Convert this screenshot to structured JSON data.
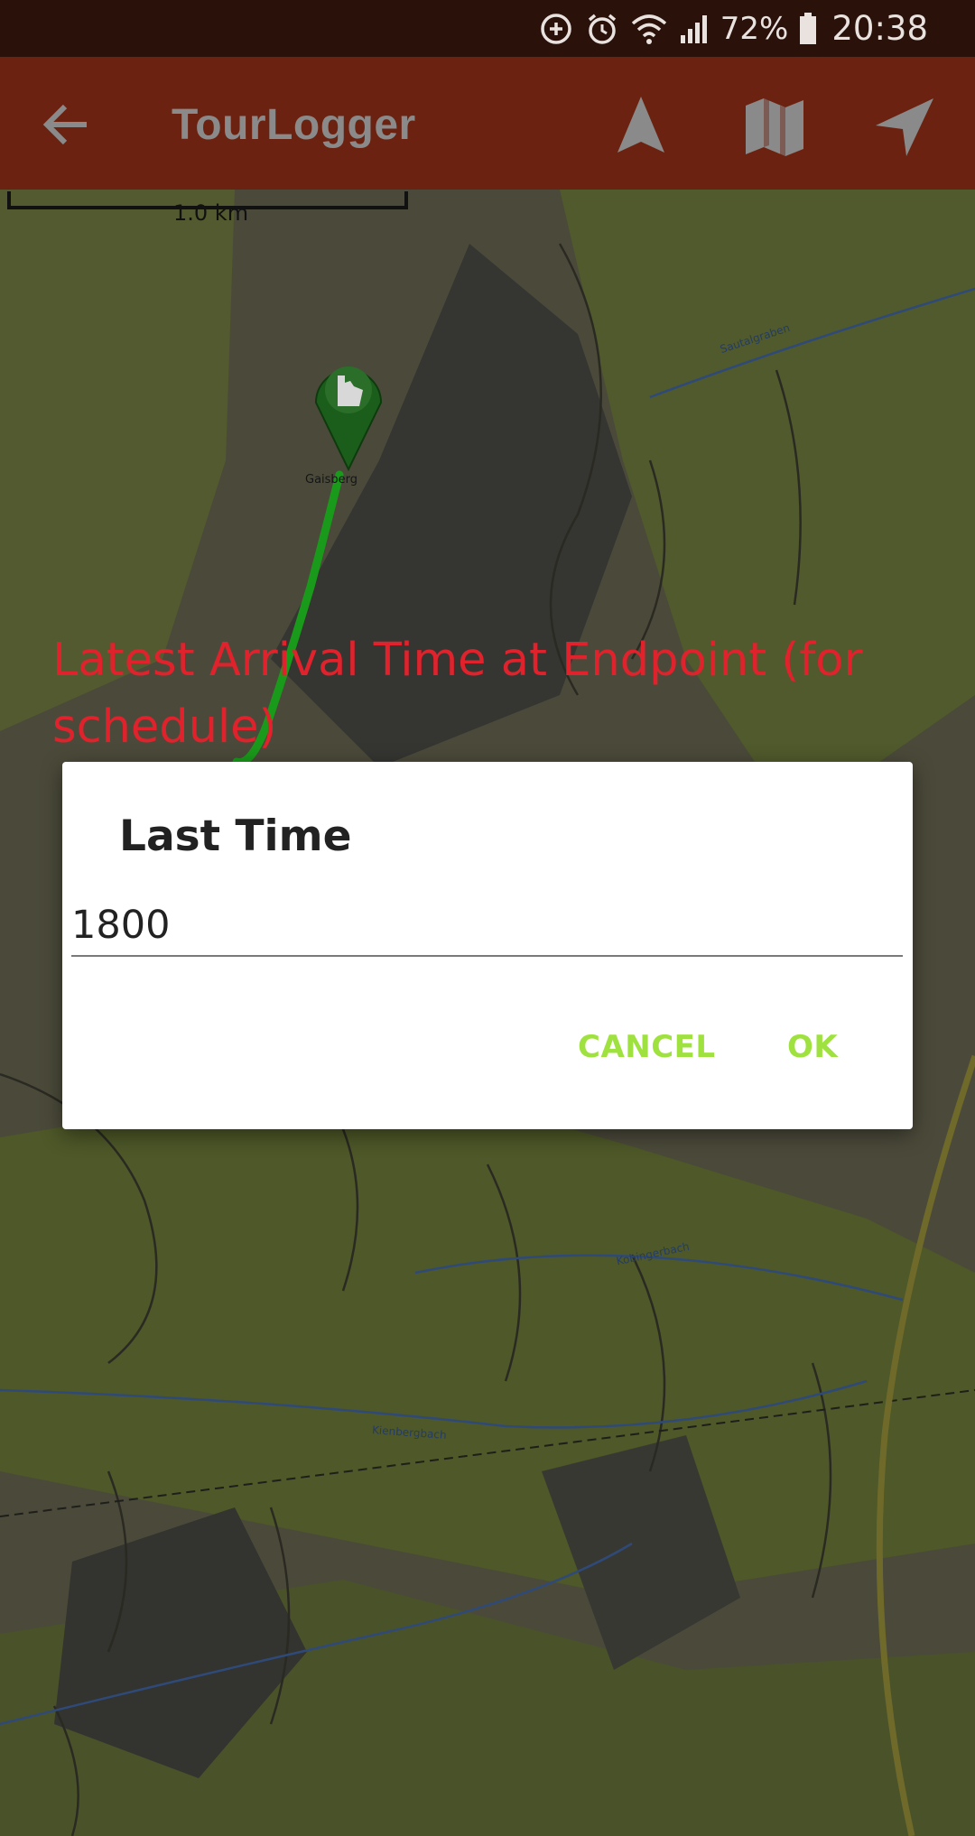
{
  "status_bar": {
    "battery_percent": "72%",
    "time": "20:38",
    "icons": [
      "sync-plus-icon",
      "alarm-icon",
      "wifi-icon",
      "signal-icon",
      "battery-icon"
    ]
  },
  "app_bar": {
    "title": "TourLogger",
    "back_icon": "arrow-back-icon",
    "actions": [
      "navigation-arrow-icon",
      "map-icon",
      "send-location-icon"
    ],
    "background": "#6b2211"
  },
  "map": {
    "scale_label": "1.0 km",
    "route_color": "#1a9a1a",
    "marker_icon": "hand-pointer-marker-icon",
    "labels": [
      "Gaisberg",
      "Sautalgraben",
      "Kobingerbach",
      "Kienbergbach"
    ]
  },
  "hint": {
    "text": "Latest Arrival Time at Endpoint (for schedule)",
    "color": "#e0222c"
  },
  "dialog": {
    "title": "Last Time",
    "input_value": "1800",
    "cancel_label": "CANCEL",
    "ok_label": "OK",
    "accent": "#9fe23f"
  }
}
